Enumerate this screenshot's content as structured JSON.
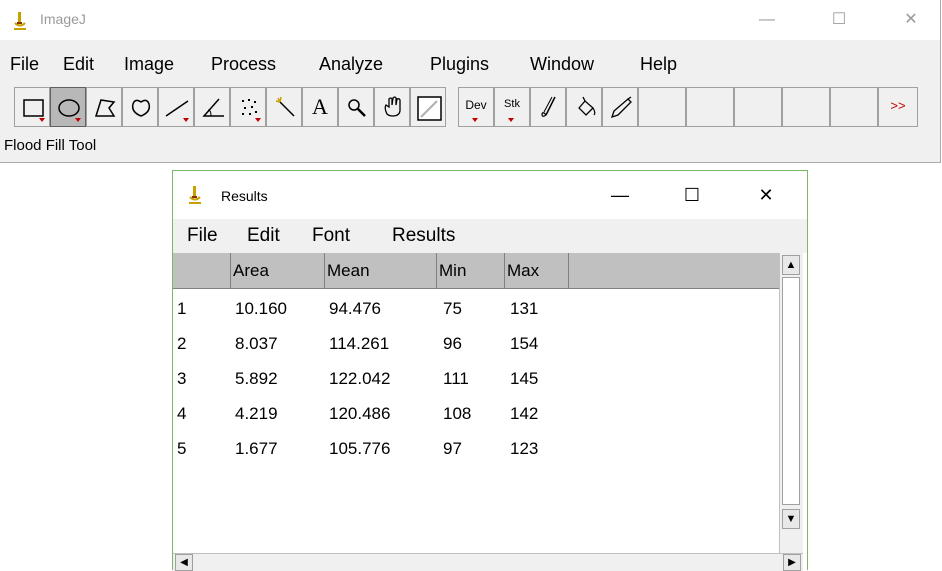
{
  "main": {
    "title": "ImageJ",
    "window_controls": {
      "minimize": "—",
      "maximize": "☐",
      "close": "✕"
    },
    "menu": [
      "File",
      "Edit",
      "Image",
      "Process",
      "Analyze",
      "Plugins",
      "Window",
      "Help"
    ],
    "toolbar": {
      "dev_label": "Dev",
      "stk_label": "Stk",
      "more_label": ">>",
      "text_tool_label": "A"
    },
    "status": "Flood Fill Tool"
  },
  "results": {
    "title": "Results",
    "window_controls": {
      "minimize": "—",
      "maximize": "☐",
      "close": "✕"
    },
    "menu": [
      "File",
      "Edit",
      "Font",
      "Results"
    ],
    "columns": [
      "",
      "Area",
      "Mean",
      "Min",
      "Max"
    ],
    "rows": [
      [
        "1",
        "10.160",
        "94.476",
        "75",
        "131"
      ],
      [
        "2",
        "8.037",
        "114.261",
        "96",
        "154"
      ],
      [
        "3",
        "5.892",
        "122.042",
        "111",
        "145"
      ],
      [
        "4",
        "4.219",
        "120.486",
        "108",
        "142"
      ],
      [
        "5",
        "1.677",
        "105.776",
        "97",
        "123"
      ]
    ],
    "scroll": {
      "up": "▲",
      "down": "▼",
      "left": "◀",
      "right": "▶"
    }
  },
  "colors": {
    "accent_green": "#7ab96b",
    "tool_triangle": "#c00000"
  }
}
